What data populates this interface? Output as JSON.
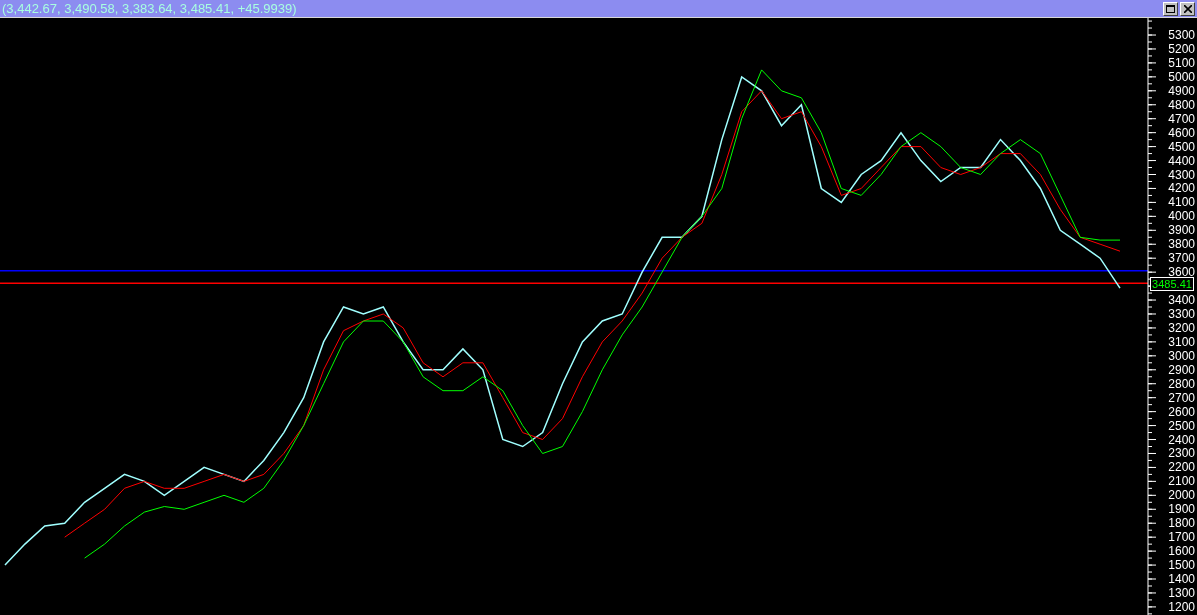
{
  "window": {
    "title": "(3,442.67, 3,490.58, 3,383.64, 3,485.41, +45.9939)"
  },
  "chart": {
    "last_value_label": "3485.41",
    "chart_data": {
      "type": "line",
      "ylim": [
        1142,
        5422
      ],
      "yticks": [
        1200,
        1300,
        1400,
        1500,
        1600,
        1700,
        1800,
        1900,
        2000,
        2100,
        2200,
        2300,
        2400,
        2500,
        2600,
        2700,
        2800,
        2900,
        3000,
        3100,
        3200,
        3300,
        3400,
        3600,
        3700,
        3800,
        3900,
        4000,
        4100,
        4200,
        4300,
        4400,
        4500,
        4600,
        4700,
        4800,
        4900,
        5000,
        5100,
        5200,
        5300
      ],
      "series": [
        {
          "color": "#a0ffff",
          "values": [
            1500,
            1650,
            1780,
            1800,
            1950,
            2050,
            2150,
            2100,
            2000,
            2100,
            2200,
            2150,
            2100,
            2250,
            2450,
            2700,
            3100,
            3350,
            3300,
            3350,
            3100,
            2900,
            2900,
            3050,
            2900,
            2400,
            2350,
            2450,
            2800,
            3100,
            3250,
            3300,
            3600,
            3850,
            3850,
            4000,
            4550,
            5000,
            4900,
            4650,
            4800,
            4200,
            4100,
            4300,
            4400,
            4600,
            4400,
            4250,
            4350,
            4350,
            4550,
            4400,
            4200,
            3900,
            3800,
            3700,
            3485
          ]
        },
        {
          "color": "#ff0000",
          "values": [
            null,
            null,
            null,
            1700,
            1800,
            1900,
            2050,
            2100,
            2050,
            2050,
            2100,
            2150,
            2100,
            2150,
            2300,
            2500,
            2900,
            3180,
            3250,
            3300,
            3200,
            2950,
            2850,
            2950,
            2950,
            2700,
            2450,
            2400,
            2550,
            2850,
            3100,
            3250,
            3450,
            3700,
            3850,
            3950,
            4300,
            4750,
            4900,
            4700,
            4750,
            4500,
            4150,
            4200,
            4350,
            4500,
            4500,
            4350,
            4300,
            4350,
            4450,
            4450,
            4300,
            4050,
            3850,
            3800,
            3750
          ]
        },
        {
          "color": "#00ff00",
          "values": [
            null,
            null,
            null,
            null,
            1550,
            1650,
            1780,
            1880,
            1920,
            1900,
            1950,
            2000,
            1950,
            2050,
            2250,
            2500,
            2800,
            3100,
            3250,
            3250,
            3100,
            2850,
            2750,
            2750,
            2850,
            2750,
            2500,
            2300,
            2350,
            2600,
            2900,
            3150,
            3350,
            3600,
            3850,
            4000,
            4200,
            4700,
            5050,
            4900,
            4850,
            4600,
            4200,
            4150,
            4300,
            4500,
            4600,
            4500,
            4350,
            4300,
            4450,
            4550,
            4450,
            4150,
            3850,
            3830,
            3830
          ]
        }
      ],
      "ref_lines": [
        {
          "axis": "y",
          "value": 3610,
          "color": "#0000ff"
        },
        {
          "axis": "y",
          "value": 3520,
          "color": "#ff0000"
        }
      ]
    }
  }
}
